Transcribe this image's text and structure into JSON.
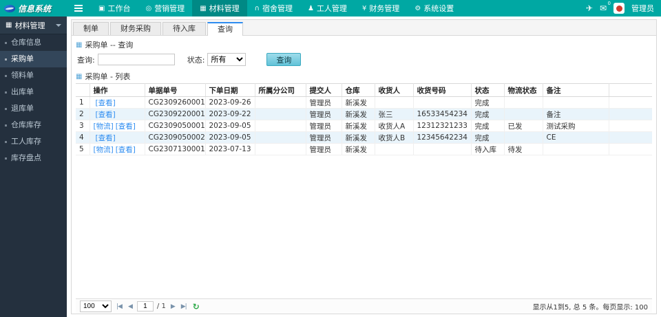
{
  "header": {
    "logo_text": "信息系统",
    "menu": [
      {
        "label": "工作台",
        "icon": "▣"
      },
      {
        "label": "营销管理",
        "icon": "◎"
      },
      {
        "label": "材料管理",
        "icon": "▦"
      },
      {
        "label": "宿舍管理",
        "icon": "∩"
      },
      {
        "label": "工人管理",
        "icon": "♟"
      },
      {
        "label": "财务管理",
        "icon": "¥"
      },
      {
        "label": "系统设置",
        "icon": "⚙"
      }
    ],
    "icons": {
      "send": "✈",
      "message": "✉"
    },
    "badge_count": "0",
    "username": "管理员"
  },
  "sidebar": {
    "title": "材料管理",
    "title_icon": "▦",
    "items": [
      {
        "label": "仓库信息"
      },
      {
        "label": "采购单"
      },
      {
        "label": "领料单"
      },
      {
        "label": "出库单"
      },
      {
        "label": "退库单"
      },
      {
        "label": "仓库库存"
      },
      {
        "label": "工人库存"
      },
      {
        "label": "库存盘点"
      }
    ]
  },
  "tabs": [
    {
      "label": "制单"
    },
    {
      "label": "财务采购"
    },
    {
      "label": "待入库"
    },
    {
      "label": "查询"
    }
  ],
  "query_panel": {
    "icon": "▦",
    "title": "采购单 -- 查询",
    "search_label": "查询:",
    "status_label": "状态:",
    "status_value": "所有",
    "button_label": "查询"
  },
  "list_panel": {
    "icon": "▦",
    "title": "采购单 - 列表",
    "columns": [
      "操作",
      "单据单号",
      "下单日期",
      "所属分公司",
      "提交人",
      "仓库",
      "收货人",
      "收货号码",
      "状态",
      "物流状态",
      "备注"
    ],
    "rows": [
      {
        "index": "1",
        "action_logistics": "",
        "action_view": "[查看]",
        "order_no": "CG2309260001",
        "order_date": "2023-09-26",
        "branch": "",
        "submitter": "管理员",
        "warehouse": "新溪发",
        "receiver": "",
        "phone": "",
        "status": "完成",
        "logistics": "",
        "remark": ""
      },
      {
        "index": "2",
        "action_logistics": "",
        "action_view": "[查看]",
        "order_no": "CG2309220001",
        "order_date": "2023-09-22",
        "branch": "",
        "submitter": "管理员",
        "warehouse": "新溪发",
        "receiver": "张三",
        "phone": "16533454234",
        "status": "完成",
        "logistics": "",
        "remark": "备注"
      },
      {
        "index": "3",
        "action_logistics": "[物流]",
        "action_view": "[查看]",
        "order_no": "CG2309050001",
        "order_date": "2023-09-05",
        "branch": "",
        "submitter": "管理员",
        "warehouse": "新溪发",
        "receiver": "收货人A",
        "phone": "12312321233",
        "status": "完成",
        "logistics": "已发",
        "remark": "测试采购"
      },
      {
        "index": "4",
        "action_logistics": "",
        "action_view": "[查看]",
        "order_no": "CG2309050002",
        "order_date": "2023-09-05",
        "branch": "",
        "submitter": "管理员",
        "warehouse": "新溪发",
        "receiver": "收货人B",
        "phone": "12345642234",
        "status": "完成",
        "logistics": "",
        "remark": "CE"
      },
      {
        "index": "5",
        "action_logistics": "[物流]",
        "action_view": "[查看]",
        "order_no": "CG2307130001",
        "order_date": "2023-07-13",
        "branch": "",
        "submitter": "管理员",
        "warehouse": "新溪发",
        "receiver": "",
        "phone": "",
        "status": "待入库",
        "logistics": "待发",
        "remark": ""
      }
    ]
  },
  "pagination": {
    "page_size": "100",
    "current_page": "1",
    "page_count_label": "/ 1",
    "icons": {
      "first": "|◀",
      "prev": "◀",
      "next": "▶",
      "last": "▶|",
      "refresh": "↻"
    },
    "summary": "显示从1到5, 总 5 条。每页显示: 100"
  }
}
